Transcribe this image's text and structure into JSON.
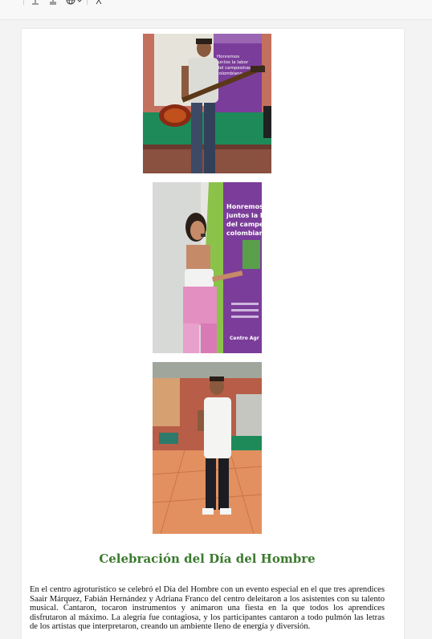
{
  "toolbar": {
    "icons": [
      "minus-icon",
      "align-top-icon",
      "align-bottom-icon",
      "globe-icon",
      "chevron-down-icon",
      "clear-format-icon"
    ]
  },
  "document": {
    "heading": "Celebración del Día del Hombre",
    "paragraph": "En el centro agroturístico se celebró el Día del Hombre con un evento especial en el que tres aprendices Saair Márquez, Fabián Hernández y Adriana Franco del centro deleitaron a los asistentes con su talento musical. Cantaron, tocaron instrumentos y animaron una fiesta en la que todos los aprendices disfrutaron al máximo. La alegría fue contagiosa, y los participantes cantaron a todo pulmón las letras de los artistas que interpretaron, creando un ambiente lleno de energía y diversión.",
    "photos": [
      {
        "id": "photo-bass-player",
        "banner_lines": [
          "Honremos",
          "juntos la labor",
          "del campesinado",
          "colombiano"
        ]
      },
      {
        "id": "photo-singer-woman",
        "banner_lines": [
          "Honremos",
          "juntos la la",
          "del campe",
          "colombian"
        ],
        "banner_footer": "Centro Agr"
      },
      {
        "id": "photo-singer-man"
      }
    ]
  },
  "colors": {
    "heading": "#3b7a2f",
    "banner_purple": "#7b3d9a",
    "banner_green": "#7cb342",
    "scroll_thumb": "#6b6b6b"
  }
}
